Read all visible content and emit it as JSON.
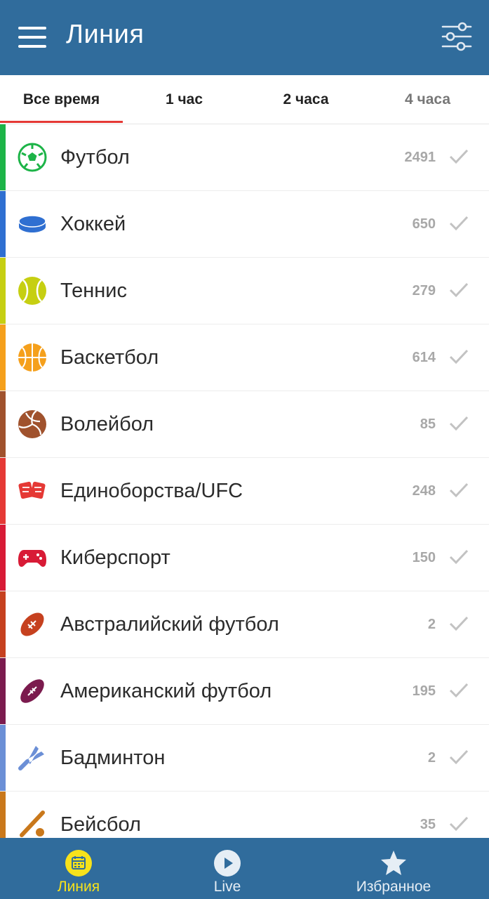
{
  "header": {
    "title": "Линия",
    "menu_icon": "hamburger-menu-icon",
    "filter_icon": "sliders-filter-icon"
  },
  "tabs": [
    {
      "label": "Все время",
      "active": true
    },
    {
      "label": "1 час",
      "active": false
    },
    {
      "label": "2 часа",
      "active": false
    },
    {
      "label": "4 часа",
      "active": false
    }
  ],
  "sports": [
    {
      "name": "Футбол",
      "count": "2491",
      "color": "#1db448",
      "icon": "soccer-ball-icon"
    },
    {
      "name": "Хоккей",
      "count": "650",
      "color": "#2f6fd1",
      "icon": "hockey-puck-icon"
    },
    {
      "name": "Теннис",
      "count": "279",
      "color": "#c6cf12",
      "icon": "tennis-ball-icon"
    },
    {
      "name": "Баскетбол",
      "count": "614",
      "color": "#f5a01c",
      "icon": "basketball-icon"
    },
    {
      "name": "Волейбол",
      "count": "85",
      "color": "#a0522d",
      "icon": "volleyball-icon"
    },
    {
      "name": "Единоборства/UFC",
      "count": "248",
      "color": "#e53935",
      "icon": "fight-gloves-icon"
    },
    {
      "name": "Киберспорт",
      "count": "150",
      "color": "#d81b36",
      "icon": "gamepad-icon"
    },
    {
      "name": "Австралийский футбол",
      "count": "2",
      "color": "#c6411f",
      "icon": "aussie-football-icon"
    },
    {
      "name": "Американский футбол",
      "count": "195",
      "color": "#7b1b4e",
      "icon": "american-football-icon"
    },
    {
      "name": "Бадминтон",
      "count": "2",
      "color": "#6b8fd6",
      "icon": "shuttlecock-icon"
    },
    {
      "name": "Бейсбол",
      "count": "35",
      "color": "#c9781b",
      "icon": "baseball-bat-icon"
    }
  ],
  "bottom_nav": [
    {
      "label": "Линия",
      "icon": "calendar-icon",
      "active": true
    },
    {
      "label": "Live",
      "icon": "play-icon",
      "active": false
    },
    {
      "label": "Избранное",
      "icon": "star-icon",
      "active": false
    }
  ],
  "colors": {
    "header_bg": "#306c9c",
    "tab_indicator": "#e53935",
    "active_nav": "#f7e21b"
  }
}
